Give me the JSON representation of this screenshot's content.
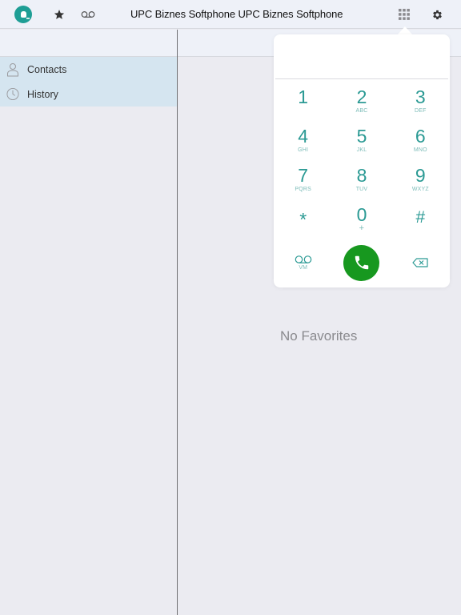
{
  "app": {
    "title": "UPC Biznes Softphone UPC Biznes Softphone"
  },
  "toolbar": {
    "icons": [
      "status-icon",
      "star-icon",
      "voicemail-icon",
      "keypad-icon",
      "gear-icon"
    ]
  },
  "sidebar": {
    "items": [
      {
        "label": "Contacts",
        "icon": "person-icon"
      },
      {
        "label": "History",
        "icon": "clock-icon"
      }
    ]
  },
  "main": {
    "empty_message": "No Favorites"
  },
  "dialpad": {
    "number_value": "",
    "keys": [
      {
        "digit": "1",
        "letters": ""
      },
      {
        "digit": "2",
        "letters": "ABC"
      },
      {
        "digit": "3",
        "letters": "DEF"
      },
      {
        "digit": "4",
        "letters": "GHI"
      },
      {
        "digit": "5",
        "letters": "JKL"
      },
      {
        "digit": "6",
        "letters": "MNO"
      },
      {
        "digit": "7",
        "letters": "PQRS"
      },
      {
        "digit": "8",
        "letters": "TUV"
      },
      {
        "digit": "9",
        "letters": "WXYZ"
      },
      {
        "digit": "*",
        "letters": ""
      },
      {
        "digit": "0",
        "letters": "+"
      },
      {
        "digit": "#",
        "letters": ""
      }
    ],
    "voicemail_label": "VM",
    "colors": {
      "accent": "#2b9a94",
      "call": "#17981f"
    }
  }
}
